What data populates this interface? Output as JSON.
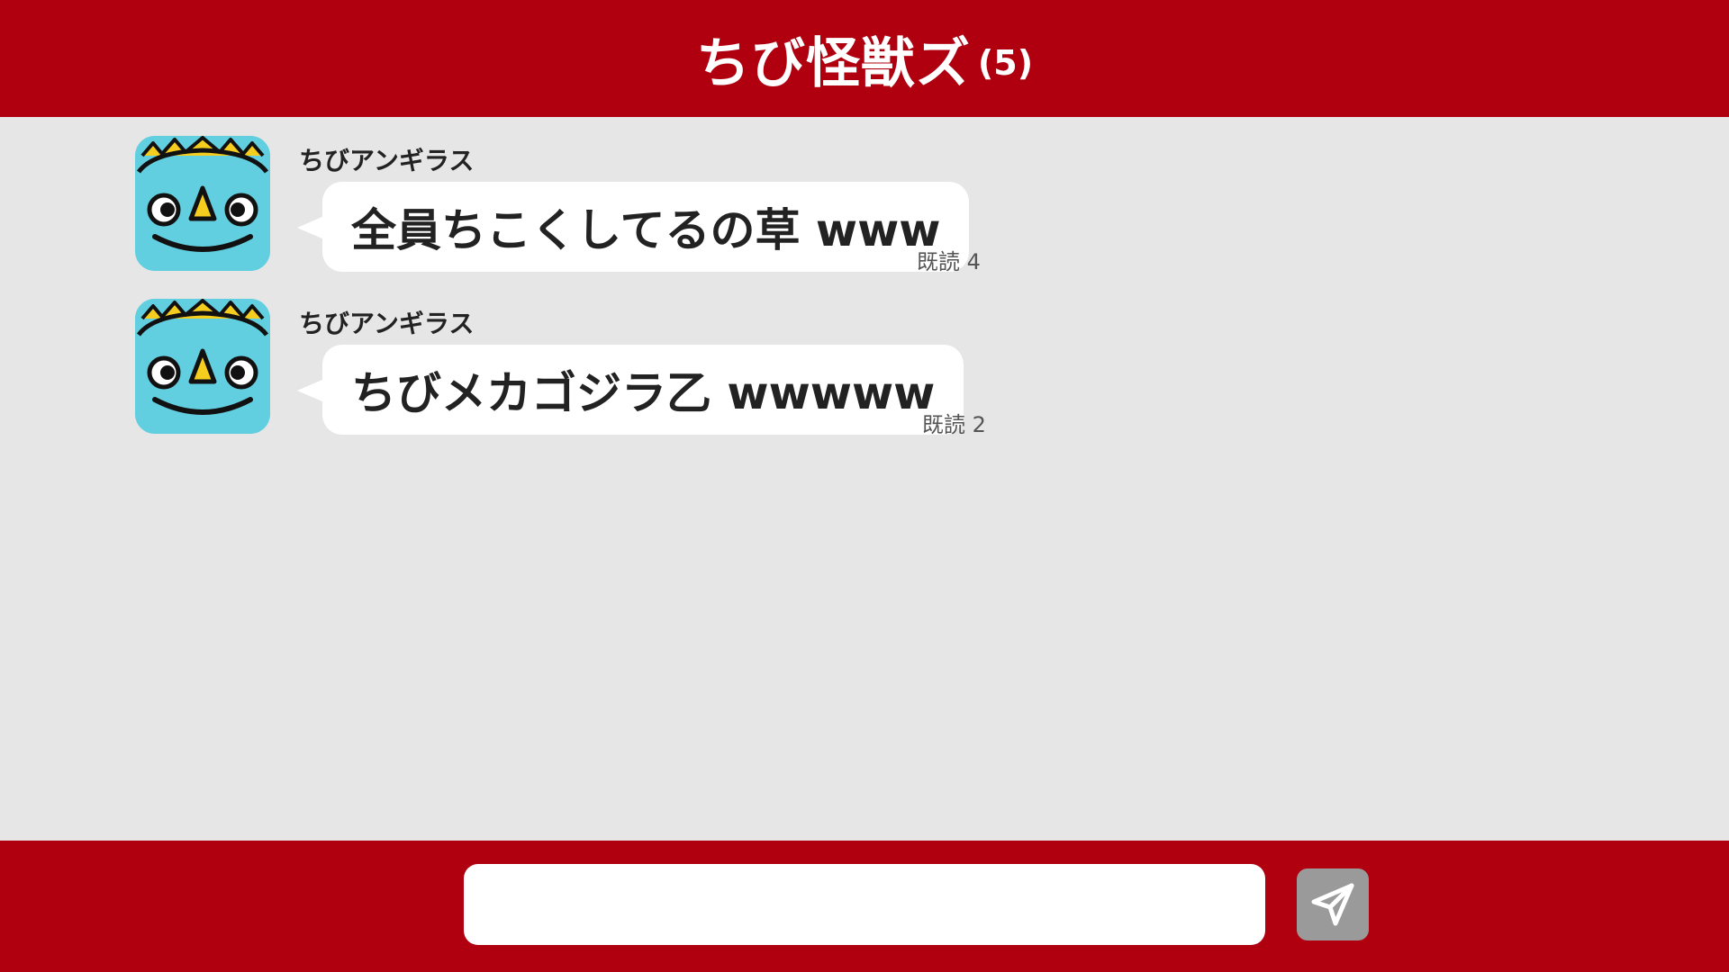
{
  "header": {
    "title": "ちび怪獣ズ",
    "member_count": "(5)"
  },
  "messages": [
    {
      "sender": "ちびアンギラス",
      "text": "全員ちこくしてるの草 www",
      "read_status": "既読 4",
      "avatar_icon": "anguirus-avatar-icon"
    },
    {
      "sender": "ちびアンギラス",
      "text": "ちびメカゴジラ乙 wwwww",
      "read_status": "既読 2",
      "avatar_icon": "anguirus-avatar-icon"
    }
  ],
  "composer": {
    "input_value": "",
    "input_placeholder": "",
    "send_icon": "send-paper-plane-icon"
  },
  "colors": {
    "header_bg": "#b00010",
    "chat_bg": "#e6e6e6",
    "bubble_bg": "#ffffff",
    "avatar_bg": "#62cfe0",
    "send_button_bg": "#9a9a9a"
  }
}
